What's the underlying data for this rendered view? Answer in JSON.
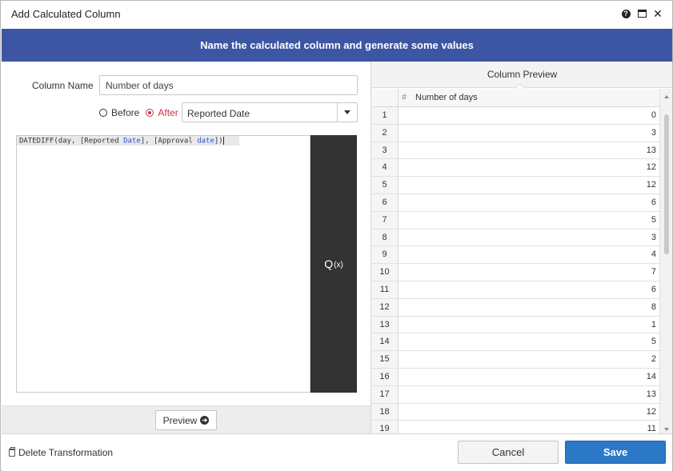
{
  "window": {
    "title": "Add Calculated Column",
    "controls": [
      "help-icon",
      "maximize-icon",
      "close-icon"
    ]
  },
  "banner": {
    "text": "Name the calculated column and generate some values"
  },
  "form": {
    "column_name_label": "Column Name",
    "column_name_value": "Number of days",
    "position": {
      "before_label": "Before",
      "after_label": "After",
      "selected": "After",
      "reference_column": "Reported Date"
    },
    "expression": {
      "fn": "DATEDIFF",
      "arg1": "(day, [Reported ",
      "arg1_kw": "Date",
      "arg2": "], [Approval ",
      "arg2_kw": "date",
      "close": "])"
    },
    "function_button_label": "Q",
    "function_button_sub": "(x)",
    "preview_button_label": "Preview"
  },
  "preview_panel": {
    "title": "Column Preview",
    "hash_label": "#",
    "column_header": "Number of days",
    "rows": [
      {
        "n": "1",
        "v": "0"
      },
      {
        "n": "2",
        "v": "3"
      },
      {
        "n": "3",
        "v": "13"
      },
      {
        "n": "4",
        "v": "12"
      },
      {
        "n": "5",
        "v": "12"
      },
      {
        "n": "6",
        "v": "6"
      },
      {
        "n": "7",
        "v": "5"
      },
      {
        "n": "8",
        "v": "3"
      },
      {
        "n": "9",
        "v": "4"
      },
      {
        "n": "10",
        "v": "7"
      },
      {
        "n": "11",
        "v": "6"
      },
      {
        "n": "12",
        "v": "8"
      },
      {
        "n": "13",
        "v": "1"
      },
      {
        "n": "14",
        "v": "5"
      },
      {
        "n": "15",
        "v": "2"
      },
      {
        "n": "16",
        "v": "14"
      },
      {
        "n": "17",
        "v": "13"
      },
      {
        "n": "18",
        "v": "12"
      },
      {
        "n": "19",
        "v": "11"
      }
    ]
  },
  "footer": {
    "delete_label": "Delete Transformation",
    "cancel_label": "Cancel",
    "save_label": "Save"
  },
  "colors": {
    "banner": "#3d56a3",
    "save": "#2a78c6",
    "accent_radio": "#c8334b",
    "function_button": "#333333"
  }
}
